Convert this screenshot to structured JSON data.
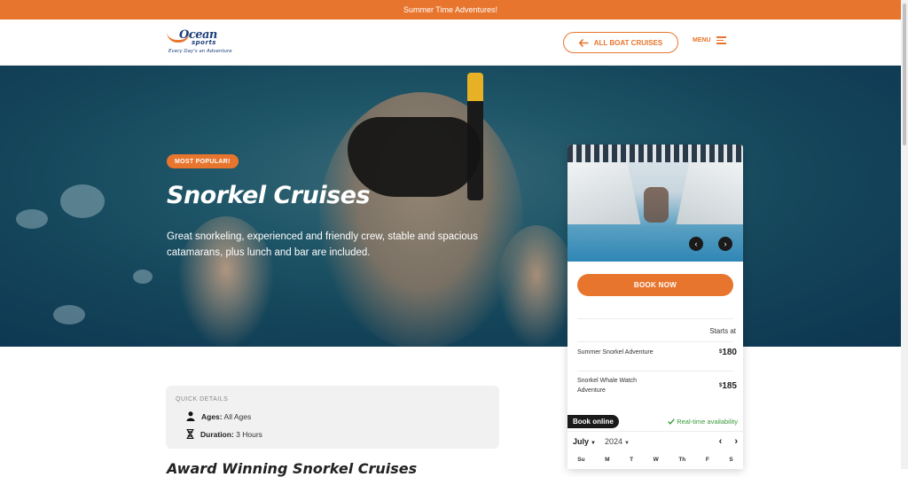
{
  "announcement": "Summer Time Adventures!",
  "header": {
    "logo_brand": "Ocean",
    "logo_brand2": "sports",
    "logo_tagline": "Every Day's an Adventure",
    "all_boats_label": "ALL BOAT CRUISES",
    "menu_label": "MENU"
  },
  "hero": {
    "badge": "MOST POPULAR!",
    "title": "Snorkel Cruises",
    "description": "Great snorkeling, experienced and friendly crew, stable and spacious catamarans, plus lunch and bar are included."
  },
  "booking": {
    "prev_icon": "‹",
    "next_icon": "›",
    "book_now": "BOOK NOW",
    "starts_at": "Starts at",
    "options": [
      {
        "name": "Summer Snorkel Adventure",
        "currency": "$",
        "price": "180"
      },
      {
        "name": "Snorkel Whale Watch Adventure",
        "currency": "$",
        "price": "185"
      }
    ],
    "book_online": "Book online",
    "realtime": "Real-time availability",
    "calendar": {
      "month": "July",
      "year": "2024",
      "weekdays": [
        "Su",
        "M",
        "T",
        "W",
        "Th",
        "F",
        "S"
      ]
    }
  },
  "quick_details": {
    "label": "QUICK DETAILS",
    "ages_label": "Ages:",
    "ages_value": "All Ages",
    "duration_label": "Duration:",
    "duration_value": "3 Hours"
  },
  "section_heading": "Award Winning Snorkel Cruises"
}
